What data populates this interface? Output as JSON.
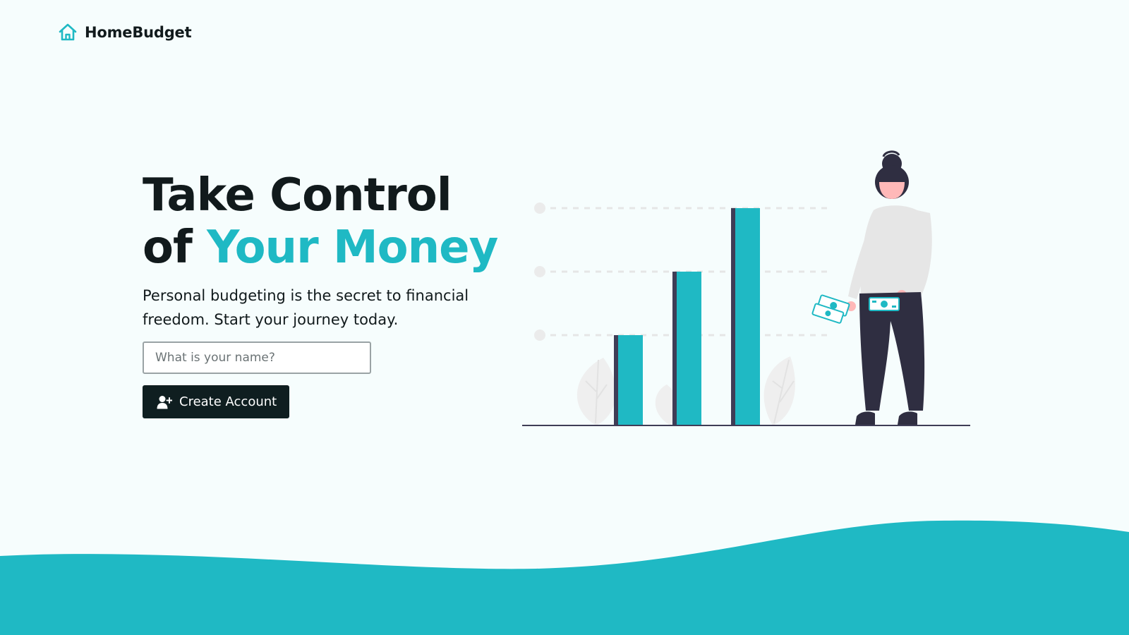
{
  "brand": {
    "name": "HomeBudget",
    "icon": "house-icon"
  },
  "hero": {
    "title_line1": "Take Control",
    "title_of": "of",
    "title_accent": "Your Money",
    "subtitle": "Personal budgeting is the secret to financial freedom. Start your journey today."
  },
  "form": {
    "name_placeholder": "What is your name?",
    "name_value": "",
    "create_label": "Create Account",
    "create_icon": "user-plus-icon"
  },
  "colors": {
    "accent": "#1fb9c4",
    "dark": "#0f1e20",
    "background": "#f6fdfd"
  }
}
